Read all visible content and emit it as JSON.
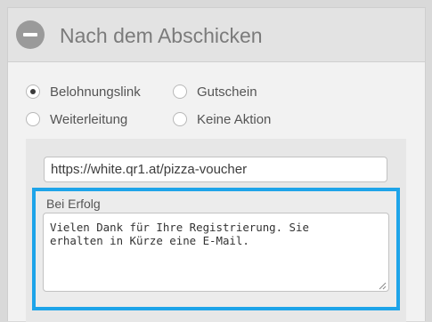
{
  "section": {
    "title": "Nach dem Abschicken",
    "collapse_icon": "minus-circle-icon"
  },
  "options": [
    {
      "label": "Belohnungslink",
      "selected": true
    },
    {
      "label": "Gutschein",
      "selected": false
    },
    {
      "label": "Weiterleitung",
      "selected": false
    },
    {
      "label": "Keine Aktion",
      "selected": false
    }
  ],
  "reward_link": {
    "value": "https://white.qr1.at/pizza-voucher"
  },
  "success": {
    "label": "Bei Erfolg",
    "message": "Vielen Dank für Ihre Registrierung. Sie\nerhalten in Kürze eine E-Mail.",
    "highlight_color": "#1ea4e9"
  }
}
